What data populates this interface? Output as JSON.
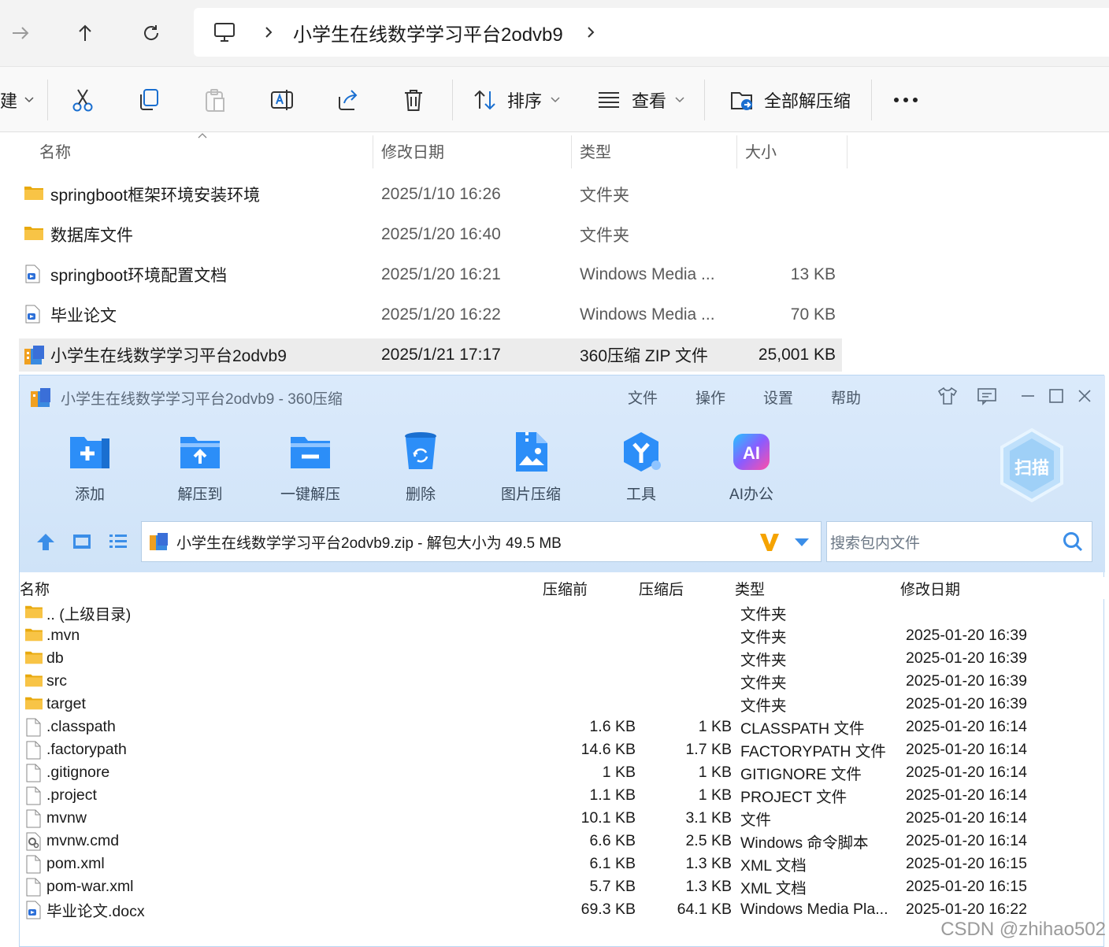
{
  "explorer": {
    "breadcrumb": [
      "小学生在线数学学习平台2odvb9"
    ],
    "toolbar": {
      "new_partial": "建",
      "sort_label": "排序",
      "view_label": "查看",
      "extract_all_label": "全部解压缩"
    },
    "columns": [
      "名称",
      "修改日期",
      "类型",
      "大小"
    ],
    "rows": [
      {
        "name": "springboot框架环境安装环境",
        "date": "2025/1/10 16:26",
        "type": "文件夹",
        "size": "",
        "icon": "folder-icon"
      },
      {
        "name": "数据库文件",
        "date": "2025/1/20 16:40",
        "type": "文件夹",
        "size": "",
        "icon": "folder-icon"
      },
      {
        "name": "springboot环境配置文档",
        "date": "2025/1/20 16:21",
        "type": "Windows Media ...",
        "size": "13 KB",
        "icon": "media-file-icon"
      },
      {
        "name": "毕业论文",
        "date": "2025/1/20 16:22",
        "type": "Windows Media ...",
        "size": "70 KB",
        "icon": "media-file-icon"
      },
      {
        "name": "小学生在线数学学习平台2odvb9",
        "date": "2025/1/21 17:17",
        "type": "360压缩 ZIP 文件",
        "size": "25,001 KB",
        "icon": "zip-archive-icon",
        "selected": true
      }
    ]
  },
  "zip_window": {
    "title": "小学生在线数学学习平台2odvb9 - 360压缩",
    "menu": [
      "文件",
      "操作",
      "设置",
      "帮助"
    ],
    "tools": [
      "添加",
      "解压到",
      "一键解压",
      "删除",
      "图片压缩",
      "工具",
      "AI办公"
    ],
    "scan_label": "扫描",
    "path_text": "小学生在线数学学习平台2odvb9.zip - 解包大小为 49.5 MB",
    "search_placeholder": "搜索包内文件",
    "columns": {
      "name": "名称",
      "before": "压缩前",
      "after": "压缩后",
      "type": "类型",
      "date": "修改日期"
    },
    "rows": [
      {
        "name": ".. (上级目录)",
        "before": "",
        "after": "",
        "type": "文件夹",
        "date": "",
        "icon": "folder"
      },
      {
        "name": ".mvn",
        "before": "",
        "after": "",
        "type": "文件夹",
        "date": "2025-01-20 16:39",
        "icon": "folder"
      },
      {
        "name": "db",
        "before": "",
        "after": "",
        "type": "文件夹",
        "date": "2025-01-20 16:39",
        "icon": "folder"
      },
      {
        "name": "src",
        "before": "",
        "after": "",
        "type": "文件夹",
        "date": "2025-01-20 16:39",
        "icon": "folder"
      },
      {
        "name": "target",
        "before": "",
        "after": "",
        "type": "文件夹",
        "date": "2025-01-20 16:39",
        "icon": "folder"
      },
      {
        "name": ".classpath",
        "before": "1.6 KB",
        "after": "1 KB",
        "type": "CLASSPATH 文件",
        "date": "2025-01-20 16:14",
        "icon": "file"
      },
      {
        "name": ".factorypath",
        "before": "14.6 KB",
        "after": "1.7 KB",
        "type": "FACTORYPATH 文件",
        "date": "2025-01-20 16:14",
        "icon": "file"
      },
      {
        "name": ".gitignore",
        "before": "1 KB",
        "after": "1 KB",
        "type": "GITIGNORE 文件",
        "date": "2025-01-20 16:14",
        "icon": "file"
      },
      {
        "name": ".project",
        "before": "1.1 KB",
        "after": "1 KB",
        "type": "PROJECT 文件",
        "date": "2025-01-20 16:14",
        "icon": "file"
      },
      {
        "name": "mvnw",
        "before": "10.1 KB",
        "after": "3.1 KB",
        "type": "文件",
        "date": "2025-01-20 16:14",
        "icon": "file"
      },
      {
        "name": "mvnw.cmd",
        "before": "6.6 KB",
        "after": "2.5 KB",
        "type": "Windows 命令脚本",
        "date": "2025-01-20 16:14",
        "icon": "script"
      },
      {
        "name": "pom.xml",
        "before": "6.1 KB",
        "after": "1.3 KB",
        "type": "XML 文档",
        "date": "2025-01-20 16:15",
        "icon": "file"
      },
      {
        "name": "pom-war.xml",
        "before": "5.7 KB",
        "after": "1.3 KB",
        "type": "XML 文档",
        "date": "2025-01-20 16:15",
        "icon": "file"
      },
      {
        "name": "毕业论文.docx",
        "before": "69.3 KB",
        "after": "64.1 KB",
        "type": "Windows Media Pla...",
        "date": "2025-01-20 16:22",
        "icon": "media"
      }
    ]
  },
  "watermark": "CSDN @zhihao502",
  "colors": {
    "folder": "#f8c446",
    "accent_blue": "#2c8ef8",
    "selected_row": "#ececec",
    "zip_header_bg": "#d6e7fa"
  }
}
